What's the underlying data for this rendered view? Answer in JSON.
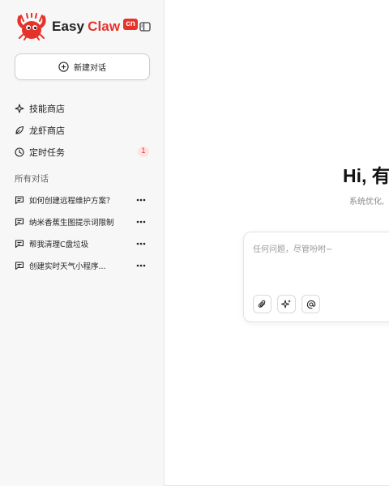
{
  "brand": {
    "name_part1": "Easy",
    "name_part2": "Claw",
    "badge": "cn"
  },
  "sidebar": {
    "new_chat_label": "新建对话",
    "nav_items": [
      {
        "label": "技能商店",
        "icon": "sparkle-icon"
      },
      {
        "label": "龙虾商店",
        "icon": "leaf-icon"
      },
      {
        "label": "定时任务",
        "icon": "clock-icon",
        "badge": "1"
      }
    ],
    "section_title": "所有对话",
    "conversations": [
      {
        "title": "如何创建远程维护方案？"
      },
      {
        "title": "纳米香蕉生图提示词限制"
      },
      {
        "title": "帮我清理C盘垃圾"
      },
      {
        "title": "创建实时天气小程序..."
      }
    ]
  },
  "main": {
    "greeting": "Hi, 有",
    "subtitle": "系统优化,",
    "input_placeholder": "任何问题，尽管吩咐~"
  },
  "colors": {
    "accent": "#e5332a",
    "sidebar_bg": "#f7f7f8"
  }
}
